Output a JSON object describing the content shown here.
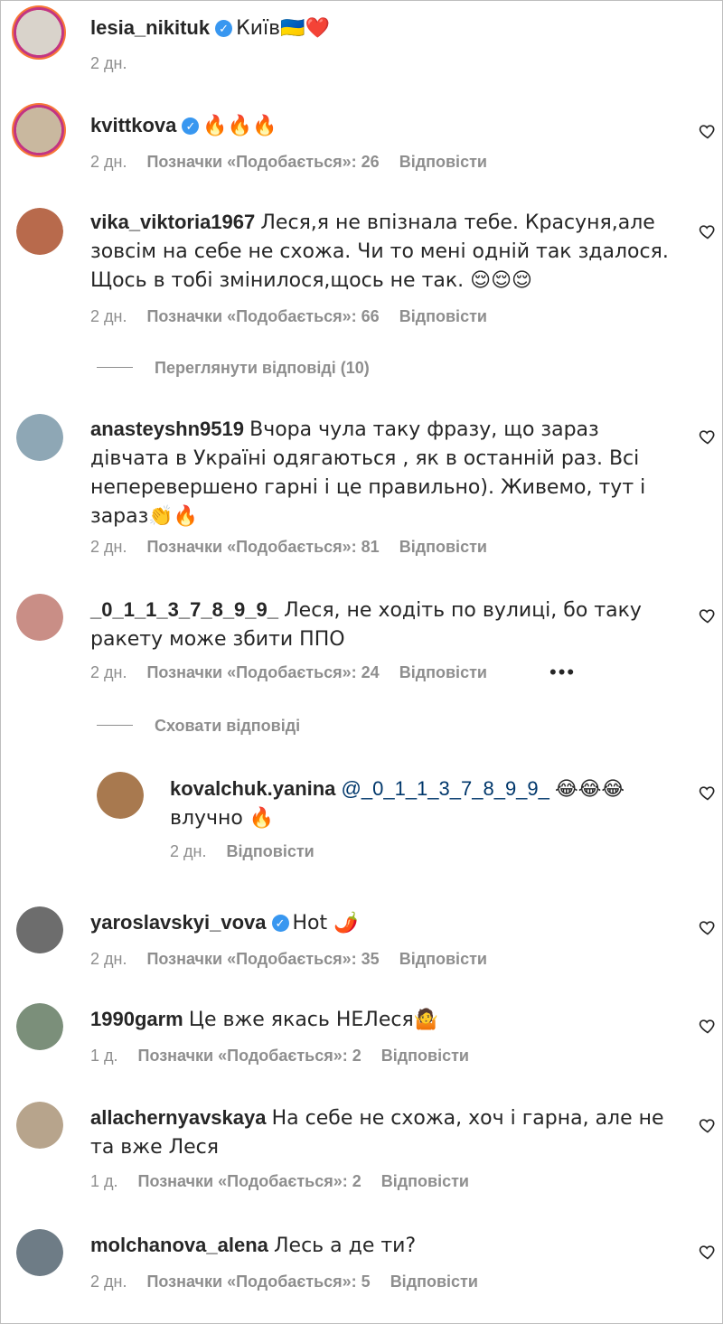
{
  "comments": [
    {
      "username": "lesia_nikituk",
      "verified": true,
      "text": "Київ🇺🇦❤️",
      "time": "2 дн.",
      "likes_label": "",
      "reply_label": "",
      "avatar_color": "#d9d3cb",
      "ring": true,
      "has_heart": false
    },
    {
      "username": "kvittkova",
      "verified": true,
      "text": "🔥🔥🔥",
      "time": "2 дн.",
      "likes_label": "Позначки «Подобається»: 26",
      "reply_label": "Відповісти",
      "avatar_color": "#c9b89f",
      "ring": true,
      "has_heart": true
    },
    {
      "username": "vika_viktoria1967",
      "verified": false,
      "text": "Леся,я не впізнала тебе. Красуня,але зовсім на себе не схожа. Чи то мені одній так здалося. Щось в тобі змінилося,щось не так. 😌😌😌",
      "time": "2 дн.",
      "likes_label": "Позначки «Подобається»: 66",
      "reply_label": "Відповісти",
      "avatar_color": "#b86a4c",
      "ring": false,
      "has_heart": true
    },
    {
      "username": "anasteyshn9519",
      "verified": false,
      "text": "Вчора чула таку фразу, що зараз дівчата в Україні одягаються , як в останній раз. Всі неперевершено гарні і це правильно). Живемо, тут і зараз👏🔥",
      "time": "2 дн.",
      "likes_label": "Позначки «Подобається»: 81",
      "reply_label": "Відповісти",
      "avatar_color": "#8ea7b5",
      "ring": false,
      "has_heart": true
    },
    {
      "username": "_0_1_1_3_7_8_9_9_",
      "verified": false,
      "text": "Леся, не ходіть по вулиці, бо таку ракету може збити ППО",
      "time": "2 дн.",
      "likes_label": "Позначки «Подобається»: 24",
      "reply_label": "Відповісти",
      "avatar_color": "#c98e86",
      "ring": false,
      "has_heart": true
    },
    {
      "username": "kovalchuk.yanina",
      "verified": false,
      "mention": "@_0_1_1_3_7_8_9_9_",
      "text": "😂😂😂 влучно 🔥",
      "time": "2 дн.",
      "likes_label": "",
      "reply_label": "Відповісти",
      "avatar_color": "#a8794f",
      "ring": false,
      "has_heart": true
    },
    {
      "username": "yaroslavskyi_vova",
      "verified": true,
      "text": "Hot 🌶️",
      "time": "2 дн.",
      "likes_label": "Позначки «Подобається»: 35",
      "reply_label": "Відповісти",
      "avatar_color": "#6d6d6d",
      "ring": false,
      "has_heart": true
    },
    {
      "username": "1990garm",
      "verified": false,
      "text": "Це вже якась НЕЛеся🤷",
      "time": "1 д.",
      "likes_label": "Позначки «Подобається»: 2",
      "reply_label": "Відповісти",
      "avatar_color": "#7b8f7a",
      "ring": false,
      "has_heart": true
    },
    {
      "username": "allachernyavskaya",
      "verified": false,
      "text": "На себе не схожа, хоч і гарна, але не та вже Леся",
      "time": "1 д.",
      "likes_label": "Позначки «Подобається»: 2",
      "reply_label": "Відповісти",
      "avatar_color": "#b7a48c",
      "ring": false,
      "has_heart": true
    },
    {
      "username": "molchanova_alena",
      "verified": false,
      "text": "Лесь а де ти?",
      "time": "2 дн.",
      "likes_label": "Позначки «Подобається»: 5",
      "reply_label": "Відповісти",
      "avatar_color": "#6e7c86",
      "ring": false,
      "has_heart": true
    }
  ],
  "threads": {
    "view_replies": "Переглянути відповіді (10)",
    "hide_replies": "Сховати відповіді"
  },
  "more_options": "•••",
  "colors": {
    "text": "#262626",
    "meta": "#8e8e8e",
    "verified": "#3897f0",
    "mention": "#00376b"
  },
  "icons": [
    "verified-badge-icon",
    "heart-icon",
    "more-options-icon"
  ]
}
